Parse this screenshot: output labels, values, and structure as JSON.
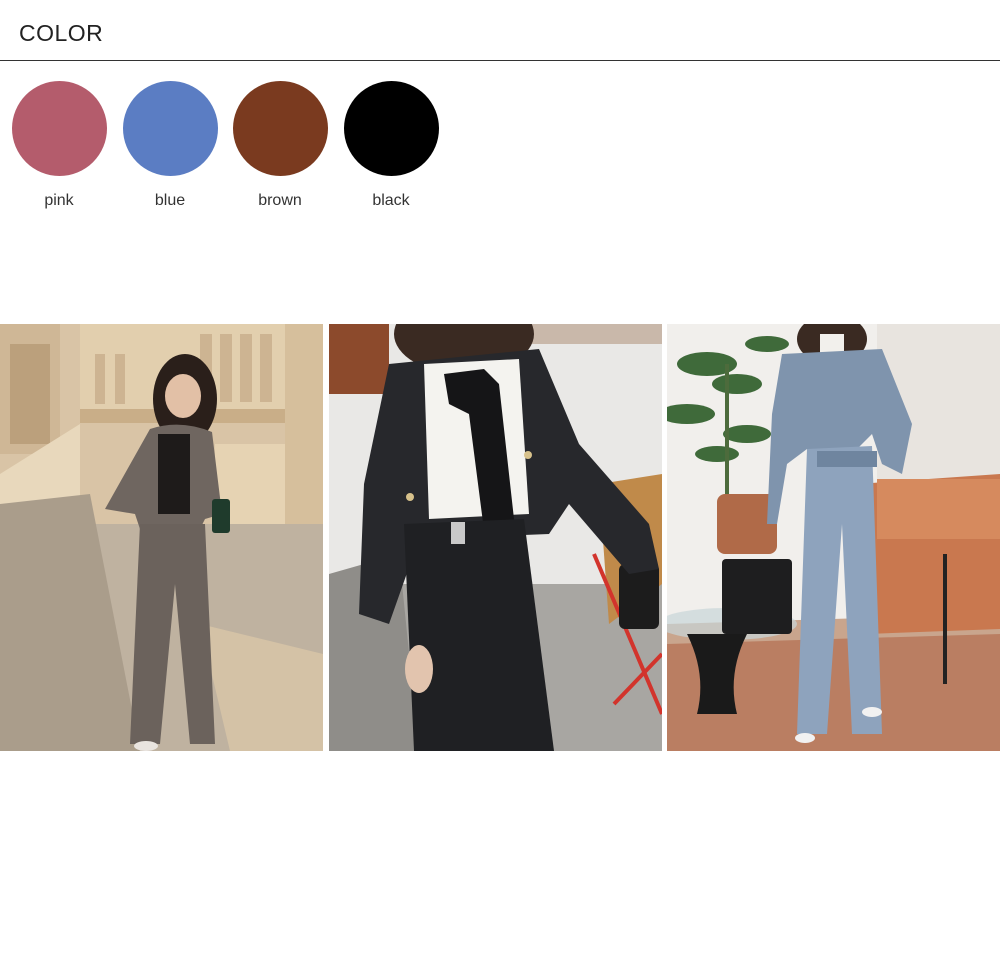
{
  "section": {
    "title": "COLOR"
  },
  "swatches": [
    {
      "label": "pink",
      "color": "#b45c6c"
    },
    {
      "label": "blue",
      "color": "#5b7dc3"
    },
    {
      "label": "brown",
      "color": "#7a3a1f"
    },
    {
      "label": "black",
      "color": "#000000"
    }
  ],
  "photos": [
    {
      "name": "brown-suit-photo",
      "scene": "street-balustrade"
    },
    {
      "name": "black-suit-photo",
      "scene": "terrace-bow-blouse"
    },
    {
      "name": "blue-suit-photo",
      "scene": "living-room-sofa"
    }
  ]
}
